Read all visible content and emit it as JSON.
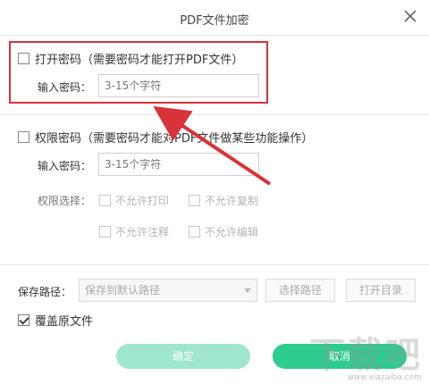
{
  "dialog": {
    "title": "PDF文件加密",
    "close_icon": "close-icon"
  },
  "open_password": {
    "checkbox_label": "打开密码（需要密码才能打开PDF文件）",
    "checked": false,
    "input_label": "输入密码：",
    "input_placeholder": "3-15个字符"
  },
  "permission_password": {
    "checkbox_label": "权限密码（需要密码才能对PDF文件做某些功能操作）",
    "checked": false,
    "input_label": "输入密码：",
    "input_placeholder": "3-15个字符",
    "perm_label": "权限选择：",
    "permissions": [
      {
        "label": "不允许打印",
        "checked": false
      },
      {
        "label": "不允许复制",
        "checked": false
      },
      {
        "label": "不允许注释",
        "checked": false
      },
      {
        "label": "不允许编辑",
        "checked": false
      }
    ]
  },
  "save": {
    "path_label": "保存路径：",
    "path_value": "保存到默认路径",
    "choose_path_button": "选择路径",
    "open_folder_button": "打开目录",
    "overwrite_label": "覆盖原文件",
    "overwrite_checked": true
  },
  "actions": {
    "confirm_button": "确定",
    "cancel_button": "取消"
  },
  "annotation": {
    "highlight_color": "#d9323a"
  },
  "watermark": {
    "logo_text": "下载吧",
    "url_text": "www.xiazaiba.com"
  },
  "colors": {
    "confirm_bg": "#9fe6cf",
    "cancel_bg": "#2ecc8f"
  }
}
